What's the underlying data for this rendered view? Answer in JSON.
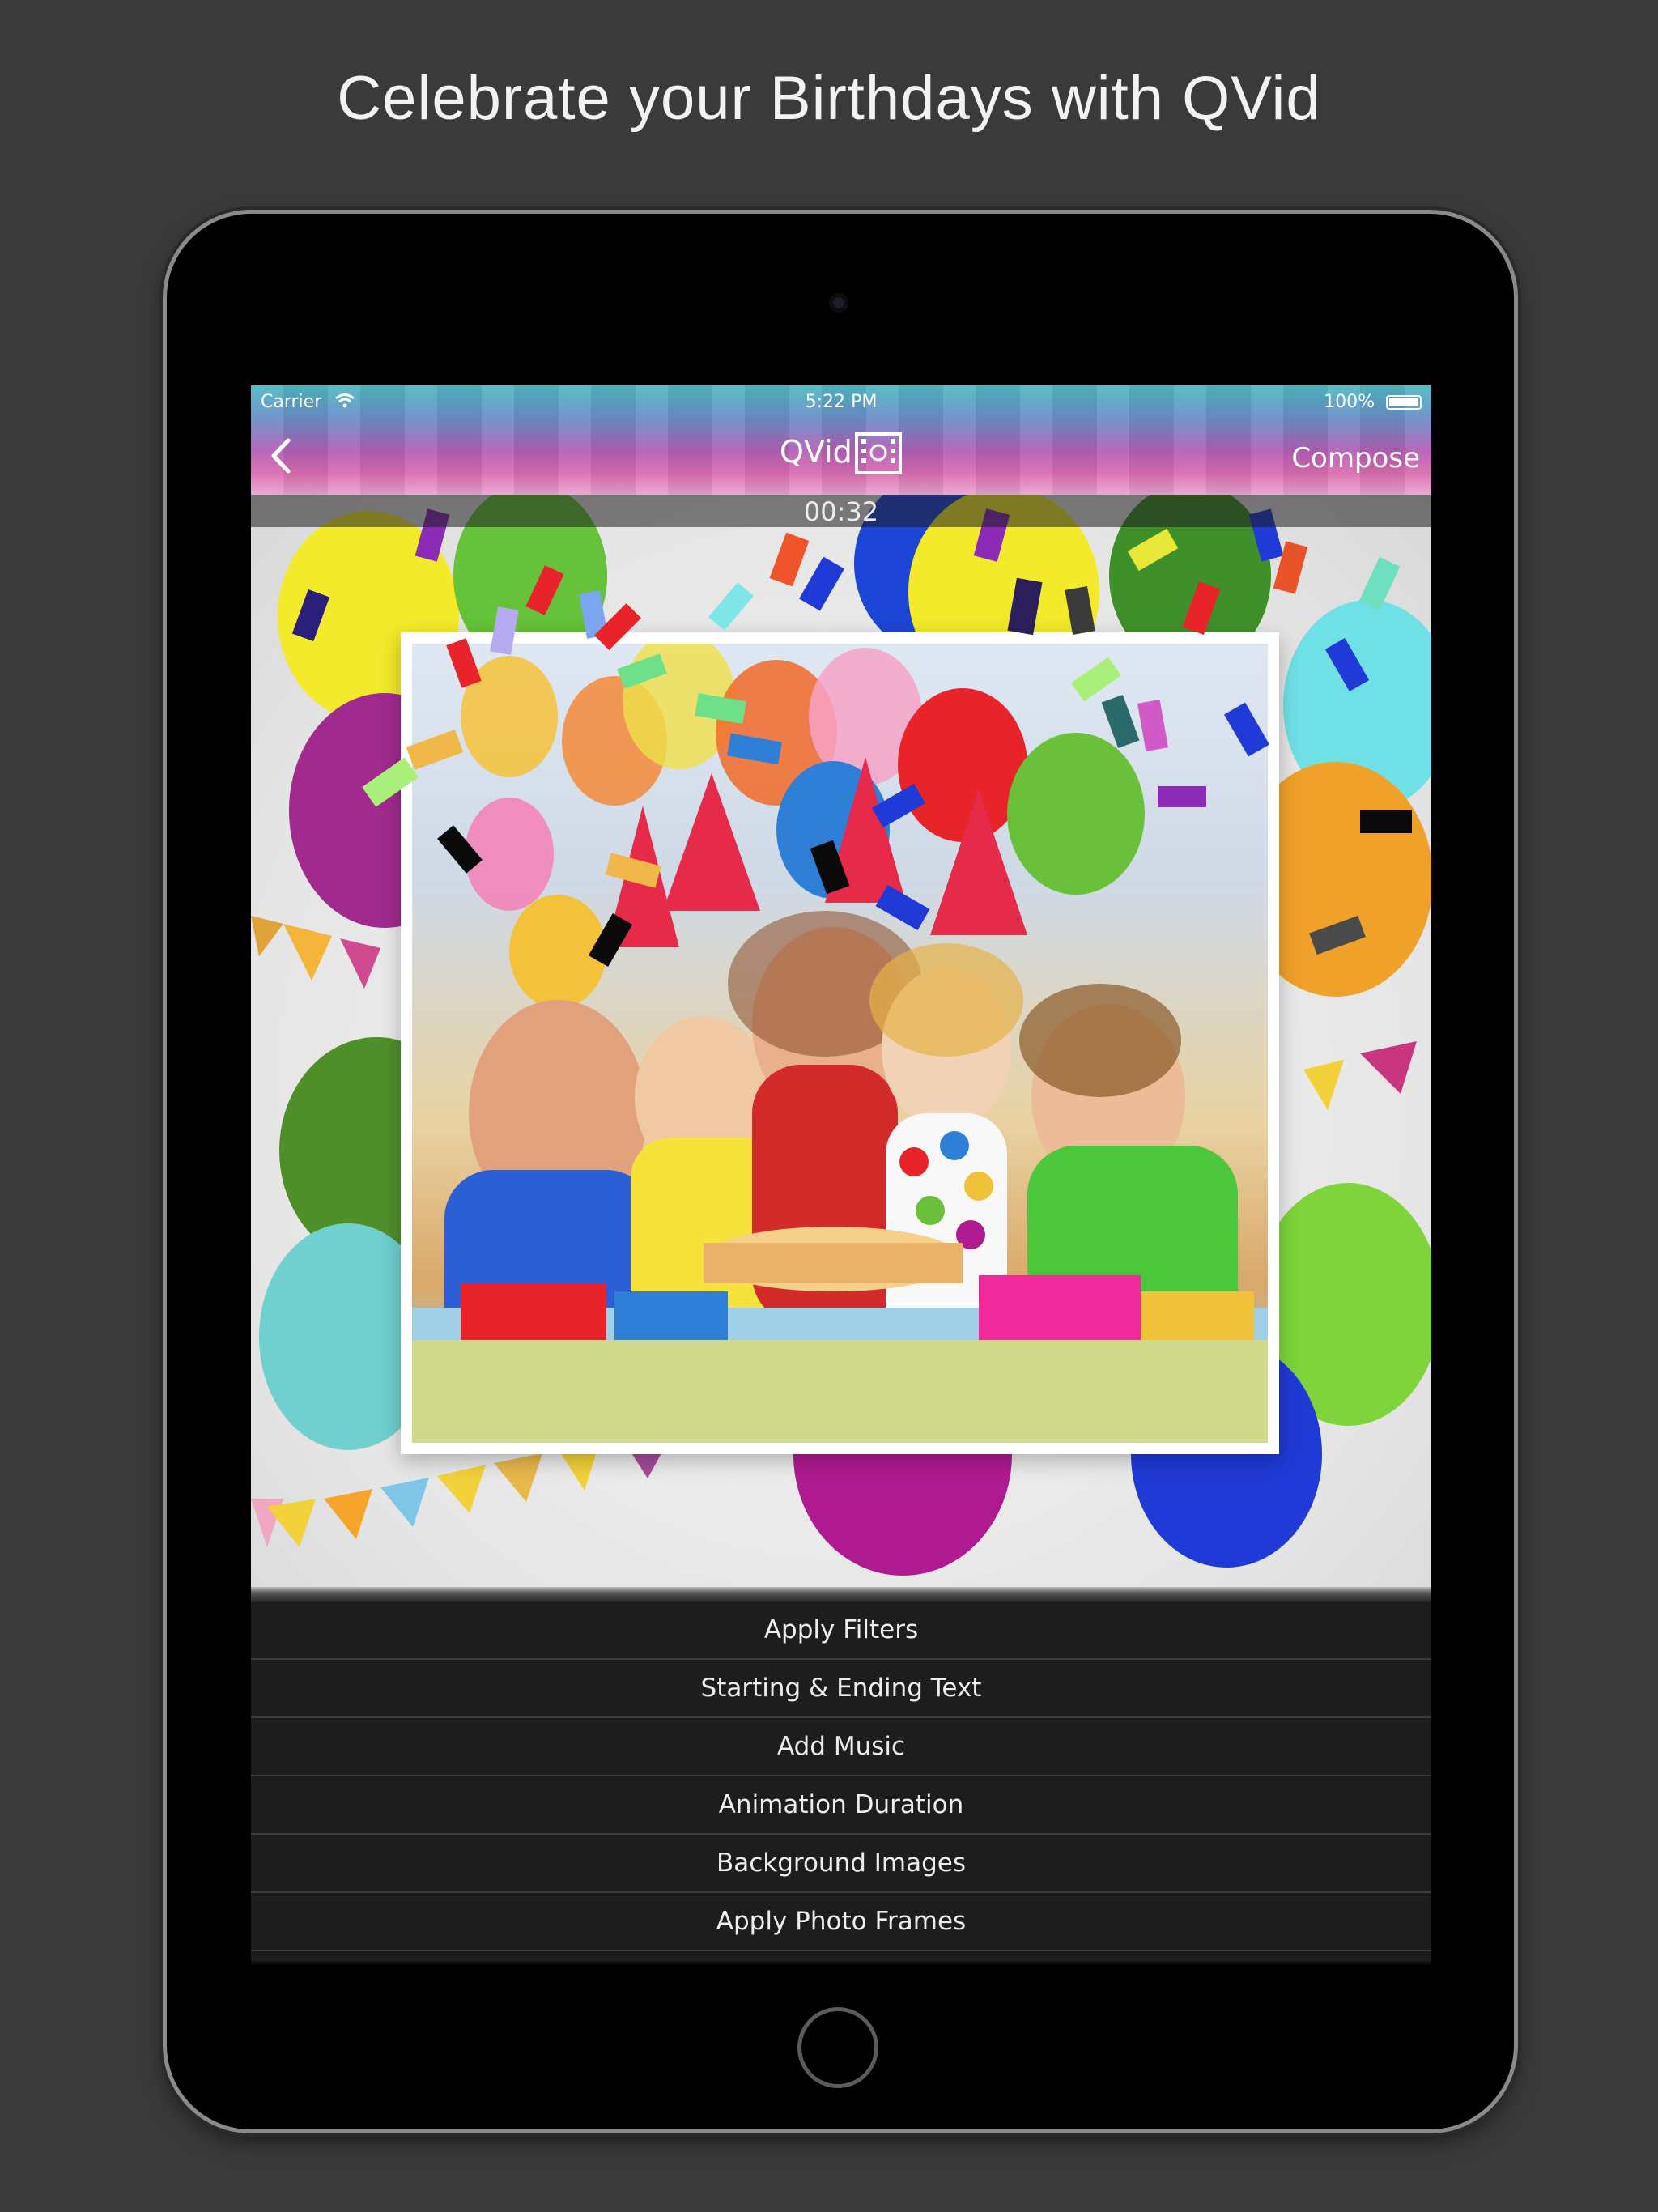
{
  "headline": "Celebrate your Birthdays with QVid",
  "status_bar": {
    "carrier": "Carrier",
    "time": "5:22 PM",
    "battery": "100%"
  },
  "nav": {
    "title": "QVid",
    "compose_label": "Compose"
  },
  "player": {
    "timer": "00:32"
  },
  "menu": {
    "items": [
      "Apply Filters",
      "Starting & Ending Text",
      "Add Music",
      "Animation Duration",
      "Background Images",
      "Apply Photo Frames"
    ]
  },
  "colors": {
    "background": "#3a3a3a",
    "device": "#000000",
    "menu_background": "#1d1d1d",
    "menu_text": "#ededed"
  },
  "icons": {
    "back": "chevron-left-icon",
    "film": "film-reel-icon",
    "wifi": "wifi-icon",
    "battery": "battery-icon"
  }
}
